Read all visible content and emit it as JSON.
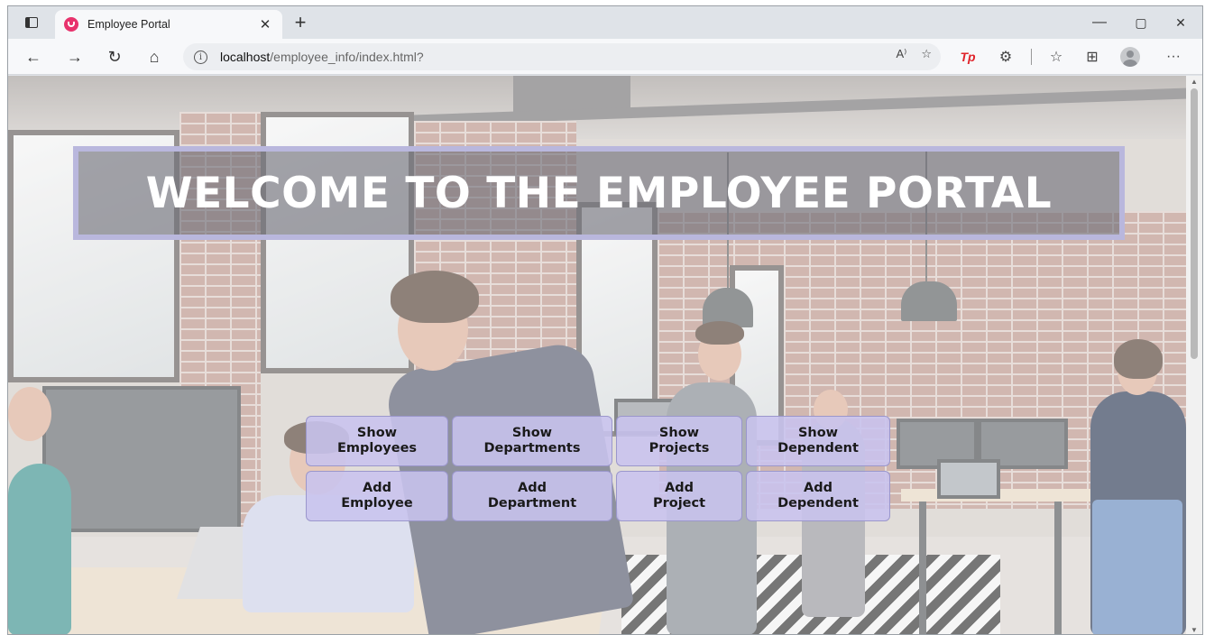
{
  "browser": {
    "tab_title": "Employee Portal",
    "tab_close": "✕",
    "new_tab": "+",
    "url_host": "localhost",
    "url_path": "/employee_info/index.html?",
    "read_aloud_label": "A⁾",
    "tp_label": "Tp",
    "more_label": "···",
    "minimize": "—",
    "restore": "▢",
    "close": "✕"
  },
  "page": {
    "banner_title": "WELCOME TO THE EMPLOYEE PORTAL",
    "buttons": [
      {
        "label": "Show\nEmployees"
      },
      {
        "label": "Show\nDepartments"
      },
      {
        "label": "Show\nProjects"
      },
      {
        "label": "Show\nDependent"
      },
      {
        "label": "Add\nEmployee"
      },
      {
        "label": "Add\nDepartment"
      },
      {
        "label": "Add\nProject"
      },
      {
        "label": "Add\nDependent"
      }
    ]
  },
  "colors": {
    "banner_border": "#b9b7dd",
    "button_fill": "#c8c3ee"
  }
}
